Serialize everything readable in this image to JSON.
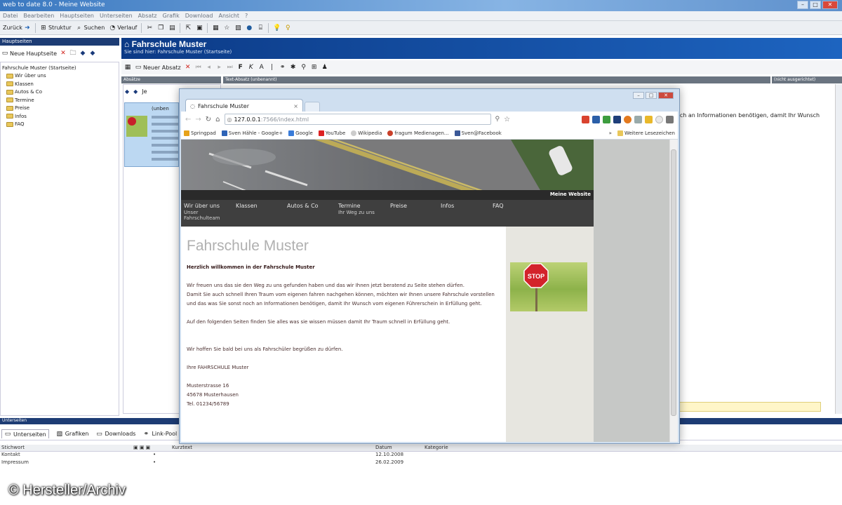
{
  "app": {
    "title": "web to date 8.0 - Meine Website",
    "menu": [
      "Datei",
      "Bearbeiten",
      "Hauptseiten",
      "Unterseiten",
      "Absatz",
      "Grafik",
      "Download",
      "Ansicht",
      "?"
    ],
    "toolbar": {
      "back": "Zurück",
      "structure": "Struktur",
      "search": "Suchen",
      "history": "Verlauf"
    }
  },
  "left": {
    "header": "Hauptseiten",
    "new_main": "Neue Hauptseite",
    "tree_root": "Fahrschule Muster (Startseite)",
    "tree_items": [
      "Wir über uns",
      "Klassen",
      "Autos & Co",
      "Termine",
      "Preise",
      "Infos",
      "FAQ"
    ]
  },
  "main": {
    "title": "Fahrschule Muster",
    "breadcrumb": "Sie sind hier: Fahrschule Muster (Startseite)",
    "new_paragraph": "Neuer Absatz",
    "col_paragraphs": "Absätze",
    "col_text": "Text-Absatz (unbenannt)",
    "col_align": "(nicht ausgerichtet)",
    "thumb_label": "(unben",
    "je_label": "Je",
    "editor_snippet": "och an Informationen benötigen, damit Ihr Wunsch"
  },
  "bottom": {
    "header": "Unterseiten",
    "tabs": [
      "Unterseiten",
      "Grafiken",
      "Downloads",
      "Link-Pool"
    ],
    "columns": [
      "Stichwort",
      "Kurztext",
      "Datum",
      "Kategorie"
    ],
    "rows": [
      {
        "keyword": "Kontakt",
        "flag": "•",
        "date": "12.10.2008"
      },
      {
        "keyword": "Impressum",
        "flag": "•",
        "date": "26.02.2009"
      }
    ]
  },
  "browser": {
    "tab_title": "Fahrschule Muster",
    "url_host": "127.0.0.1",
    "url_rest": ":7566/index.html",
    "bookmarks": [
      "Springpad",
      "Sven Hähle - Google+",
      "Google",
      "YouTube",
      "Wikipedia",
      "fragum Medienagen...",
      "Sven@Facebook"
    ],
    "bookmarks_more": "»",
    "other_bookmarks": "Weitere Lesezeichen"
  },
  "site": {
    "name": "Meine Website",
    "nav": [
      "Wir über uns",
      "Klassen",
      "Autos & Co",
      "Termine",
      "Preise",
      "Infos",
      "FAQ"
    ],
    "nav_sub": [
      "Unser Fahrschulteam",
      "Ihr Weg zu uns"
    ],
    "heading": "Fahrschule Muster",
    "welcome": "Herzlich willkommen in der Fahrschule Muster",
    "p1": "Wir freuen uns das sie den Weg zu uns gefunden haben und das wir Ihnen jetzt beratend zu Seite stehen dürfen.",
    "p2": "Damit Sie auch schnell Ihren Traum vom eigenen fahren nachgehen können, möchten wir Ihnen unsere Fahrschule vorstellen und das was Sie sonst noch an Informationen benötigen, damit Ihr Wunsch vom eigenen Führerschein in Erfüllung geht.",
    "p3": "Auf den folgenden Seiten finden Sie alles was sie wissen müssen damit Ihr Traum schnell in Erfüllung geht.",
    "p4": "Wir hoffen Sie bald bei uns als Fahrschüler begrüßen zu dürfen.",
    "signature": "Ihre FAHRSCHULE Muster",
    "street": "Musterstrasse 16",
    "city": "45678 Musterhausen",
    "phone": "Tel. 01234/56789",
    "stop_sign": "STOP"
  },
  "credit": "© Hersteller/Archiv"
}
